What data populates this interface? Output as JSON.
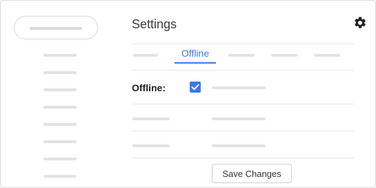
{
  "header": {
    "title": "Settings",
    "settings_icon": "gear-icon"
  },
  "tabs": {
    "active_label": "Offline"
  },
  "offline_section": {
    "label": "Offline:",
    "checkbox_checked": true,
    "checkbox_icon": "checkmark-icon"
  },
  "footer": {
    "save_label": "Save Changes"
  },
  "colors": {
    "accent": "#3b78e7",
    "placeholder": "#e2e2e2",
    "divider": "#e6e6e6"
  }
}
